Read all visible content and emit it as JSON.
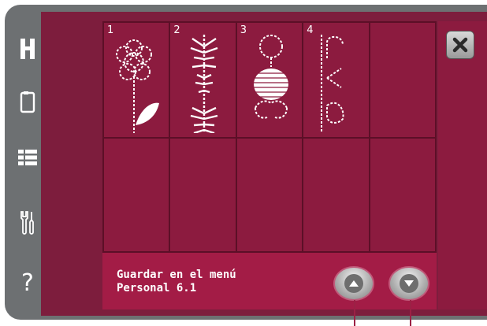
{
  "sidebar": {
    "items": [
      {
        "icon": "hoop-h-icon"
      },
      {
        "icon": "embroidery-frame-icon"
      },
      {
        "icon": "list-menu-icon"
      },
      {
        "icon": "tools-icon"
      },
      {
        "icon": "help-icon",
        "label": "?"
      }
    ]
  },
  "grid": {
    "cells": [
      {
        "number": "1",
        "icon": "flower-stitch-icon"
      },
      {
        "number": "2",
        "icon": "fern-stitch-icon"
      },
      {
        "number": "3",
        "icon": "figure-stitch-icon"
      },
      {
        "number": "4",
        "icon": "letters-stitch-icon"
      },
      {
        "number": ""
      },
      {
        "number": ""
      },
      {
        "number": ""
      },
      {
        "number": ""
      },
      {
        "number": ""
      },
      {
        "number": ""
      }
    ]
  },
  "bottom": {
    "label": "Guardar en el menú\nPersonal 6.1",
    "up_button": "arrow-up-icon",
    "down_button": "arrow-down-icon"
  },
  "close_button": "close-icon",
  "colors": {
    "screen": "#7d1d3d",
    "cell": "#8c1b3f",
    "bar": "#a31c46",
    "frame": "#6d7072"
  }
}
